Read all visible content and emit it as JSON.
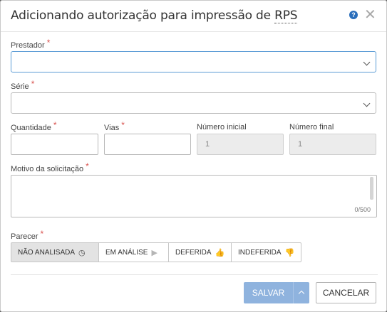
{
  "dialog": {
    "title_prefix": "Adicionando autorização para impressão de ",
    "title_abbr": "RPS",
    "help_glyph": "?",
    "close_glyph": "✕"
  },
  "fields": {
    "required_mark": "*",
    "prestador": {
      "label": "Prestador",
      "value": ""
    },
    "serie": {
      "label": "Série",
      "value": ""
    },
    "quantidade": {
      "label": "Quantidade",
      "value": ""
    },
    "vias": {
      "label": "Vias",
      "value": ""
    },
    "numero_inicial": {
      "label": "Número inicial",
      "value": "1"
    },
    "numero_final": {
      "label": "Número final",
      "value": "1"
    },
    "motivo": {
      "label": "Motivo da solicitação",
      "value": "",
      "counter": "0/500"
    }
  },
  "parecer": {
    "label": "Parecer",
    "options": [
      {
        "label": "NÃO ANALISADA",
        "icon": "clock-icon",
        "glyph": "◷",
        "selected": true
      },
      {
        "label": "EM ANÁLISE",
        "icon": "play-icon",
        "glyph": "▶",
        "selected": false
      },
      {
        "label": "DEFERIDA",
        "icon": "thumbs-up-icon",
        "glyph": "👍",
        "selected": false
      },
      {
        "label": "INDEFERIDA",
        "icon": "thumbs-down-icon",
        "glyph": "👎",
        "selected": false
      }
    ]
  },
  "footer": {
    "save_label": "SALVAR",
    "cancel_label": "CANCELAR"
  },
  "colors": {
    "primary_disabled": "#8fb3de",
    "required": "#d9534f",
    "help": "#2a6ebb",
    "focus": "#5b9bd5"
  }
}
